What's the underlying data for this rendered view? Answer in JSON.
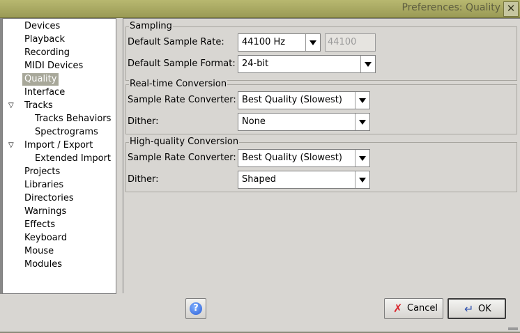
{
  "window": {
    "title": "Preferences: Quality",
    "close_glyph": "✕"
  },
  "tree": {
    "items": [
      {
        "label": "Devices"
      },
      {
        "label": "Playback"
      },
      {
        "label": "Recording"
      },
      {
        "label": "MIDI Devices"
      },
      {
        "label": "Quality",
        "selected": true
      },
      {
        "label": "Interface"
      },
      {
        "label": "Tracks",
        "expanded": true
      },
      {
        "label": "Tracks Behaviors"
      },
      {
        "label": "Spectrograms"
      },
      {
        "label": "Import / Export",
        "expanded": true
      },
      {
        "label": "Extended Import"
      },
      {
        "label": "Projects"
      },
      {
        "label": "Libraries"
      },
      {
        "label": "Directories"
      },
      {
        "label": "Warnings"
      },
      {
        "label": "Effects"
      },
      {
        "label": "Keyboard"
      },
      {
        "label": "Mouse"
      },
      {
        "label": "Modules"
      }
    ],
    "expander_glyph": "▽"
  },
  "sampling": {
    "title": "Sampling",
    "rate_label": "Default Sample Rate:",
    "rate_value": "44100 Hz",
    "rate_custom": "44100",
    "format_label": "Default Sample Format:",
    "format_value": "24-bit"
  },
  "realtime": {
    "title": "Real-time Conversion",
    "converter_label": "Sample Rate Converter:",
    "converter_value": "Best Quality (Slowest)",
    "dither_label": "Dither:",
    "dither_value": "None"
  },
  "highquality": {
    "title": "High-quality Conversion",
    "converter_label": "Sample Rate Converter:",
    "converter_value": "Best Quality (Slowest)",
    "dither_label": "Dither:",
    "dither_value": "Shaped"
  },
  "buttons": {
    "help_glyph": "?",
    "cancel_label": "Cancel",
    "cancel_glyph": "✗",
    "ok_label": "OK",
    "ok_glyph": "↵"
  },
  "colors": {
    "selection": "#a8a89a",
    "titlebar": "#b8b870",
    "cancel_icon": "#d9232a"
  }
}
